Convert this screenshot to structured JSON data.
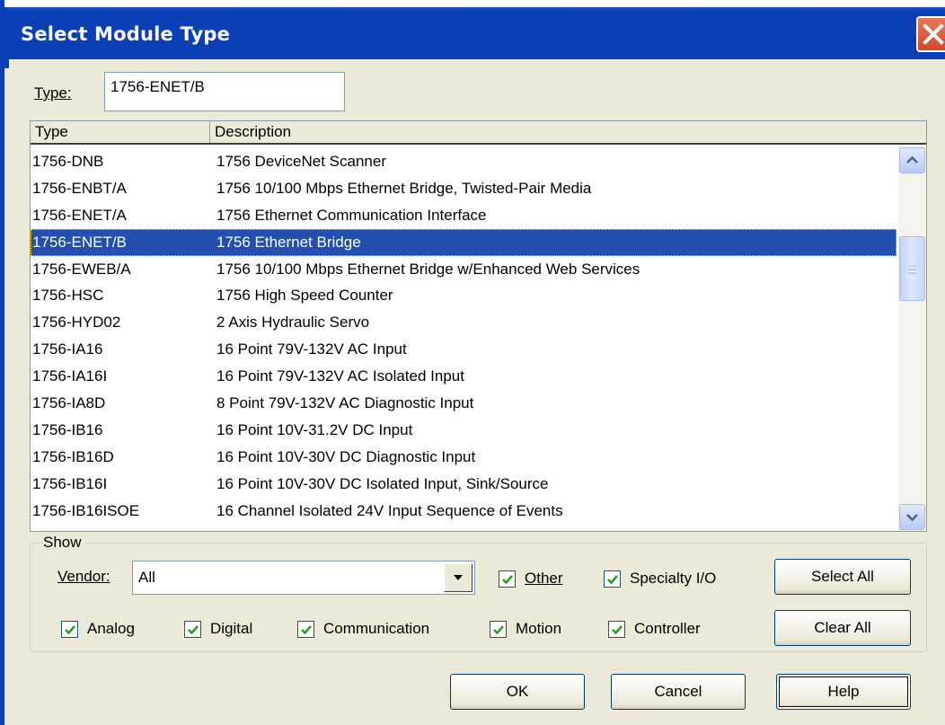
{
  "dialog": {
    "title": "Select Module Type"
  },
  "type_filter": {
    "label": "Type:",
    "value": "1756-ENET/B"
  },
  "list": {
    "columns": [
      "Type",
      "Description"
    ],
    "rows": [
      {
        "type": "1756-DNB",
        "description": "1756 DeviceNet Scanner"
      },
      {
        "type": "1756-ENBT/A",
        "description": "1756 10/100 Mbps Ethernet Bridge, Twisted-Pair Media"
      },
      {
        "type": "1756-ENET/A",
        "description": "1756 Ethernet Communication Interface"
      },
      {
        "type": "1756-ENET/B",
        "description": "1756 Ethernet Bridge"
      },
      {
        "type": "1756-EWEB/A",
        "description": "1756 10/100 Mbps Ethernet Bridge w/Enhanced Web Services"
      },
      {
        "type": "1756-HSC",
        "description": "1756 High Speed Counter"
      },
      {
        "type": "1756-HYD02",
        "description": "2 Axis Hydraulic Servo"
      },
      {
        "type": "1756-IA16",
        "description": "16 Point 79V-132V AC Input"
      },
      {
        "type": "1756-IA16I",
        "description": "16 Point 79V-132V AC Isolated Input"
      },
      {
        "type": "1756-IA8D",
        "description": "8 Point 79V-132V AC Diagnostic Input"
      },
      {
        "type": "1756-IB16",
        "description": "16 Point 10V-31.2V DC Input"
      },
      {
        "type": "1756-IB16D",
        "description": "16 Point 10V-30V DC Diagnostic Input"
      },
      {
        "type": "1756-IB16I",
        "description": "16 Point 10V-30V DC Isolated Input, Sink/Source"
      },
      {
        "type": "1756-IB16ISOE",
        "description": "16 Channel Isolated 24V Input Sequence of Events"
      }
    ],
    "selected_index": 3
  },
  "show": {
    "legend": "Show",
    "vendor_label": "Vendor:",
    "vendor_value": "All",
    "checkboxes": {
      "other": {
        "label": "Other",
        "checked": true
      },
      "specialty": {
        "label": "Specialty I/O",
        "checked": true
      },
      "analog": {
        "label": "Analog",
        "checked": true
      },
      "digital": {
        "label": "Digital",
        "checked": true
      },
      "communication": {
        "label": "Communication",
        "checked": true
      },
      "motion": {
        "label": "Motion",
        "checked": true
      },
      "controller": {
        "label": "Controller",
        "checked": true
      }
    },
    "select_all": "Select All",
    "clear_all": "Clear All"
  },
  "buttons": {
    "ok": "OK",
    "cancel": "Cancel",
    "help": "Help"
  },
  "colors": {
    "titlebar": "#0a3fb5",
    "selection": "#2350b0",
    "dialog_bg": "#ece9d8"
  }
}
